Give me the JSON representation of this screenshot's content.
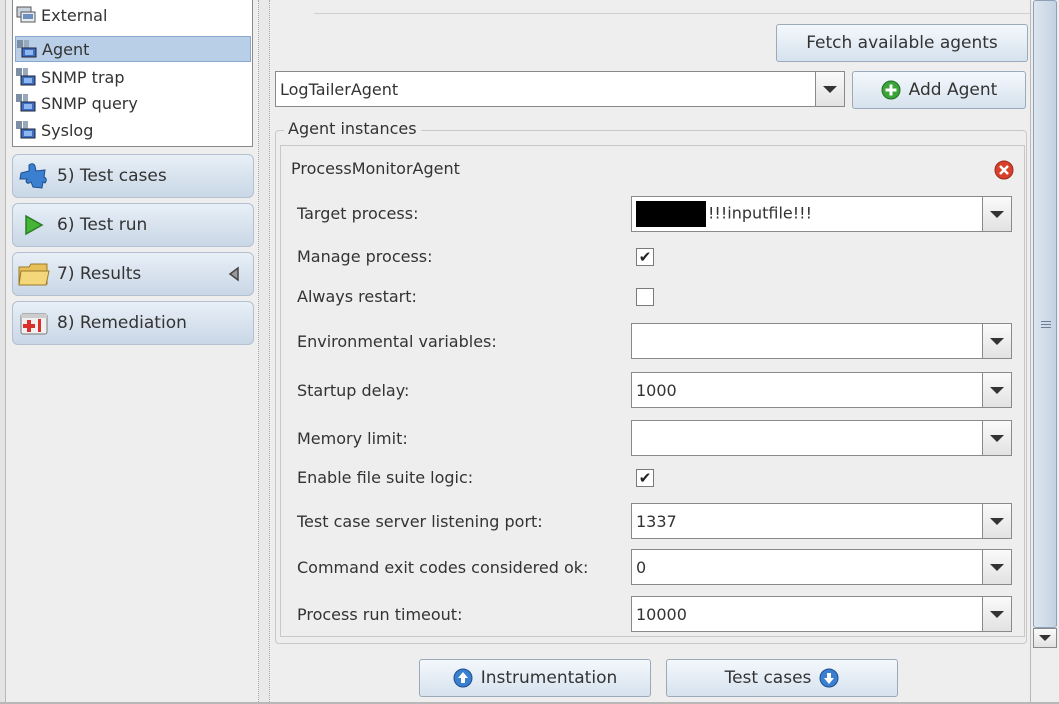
{
  "tree": {
    "items": [
      {
        "label": "External",
        "icon": "external-icon"
      },
      {
        "label": "Agent",
        "icon": "agent-icon",
        "selected": true
      },
      {
        "label": "SNMP trap",
        "icon": "agent-icon"
      },
      {
        "label": "SNMP query",
        "icon": "agent-icon"
      },
      {
        "label": "Syslog",
        "icon": "agent-icon"
      }
    ]
  },
  "nav": {
    "items": [
      {
        "label": "5) Test cases",
        "icon": "puzzle-icon"
      },
      {
        "label": "6) Test run",
        "icon": "play-icon"
      },
      {
        "label": "7) Results",
        "icon": "folder-icon"
      },
      {
        "label": "8) Remediation",
        "icon": "first-aid-icon"
      }
    ]
  },
  "toolbar": {
    "fetch_label": "Fetch available agents",
    "agent_select_value": "LogTailerAgent",
    "add_agent_label": "Add Agent"
  },
  "instances": {
    "legend": "Agent instances",
    "title": "ProcessMonitorAgent",
    "fields": {
      "target_process": {
        "label": "Target process:",
        "value": "!!!inputfile!!!"
      },
      "manage_process": {
        "label": "Manage process:",
        "checked": true,
        "mark": "✔"
      },
      "always_restart": {
        "label": "Always restart:",
        "checked": false,
        "mark": ""
      },
      "env_vars": {
        "label": "Environmental variables:",
        "value": ""
      },
      "startup_delay": {
        "label": "Startup delay:",
        "value": "1000"
      },
      "memory_limit": {
        "label": "Memory limit:",
        "value": ""
      },
      "file_suite": {
        "label": "Enable file suite logic:",
        "checked": true,
        "mark": "✔"
      },
      "listen_port": {
        "label": "Test case server listening port:",
        "value": "1337"
      },
      "exit_codes": {
        "label": "Command exit codes considered ok:",
        "value": "0"
      },
      "run_timeout": {
        "label": "Process run timeout:",
        "value": "10000"
      }
    }
  },
  "footer": {
    "prev_label": "Instrumentation",
    "next_label": "Test cases"
  },
  "colors": {
    "button_blue": "#3a7fd0",
    "remove_red": "#d9402b",
    "add_green": "#3aa33a"
  }
}
